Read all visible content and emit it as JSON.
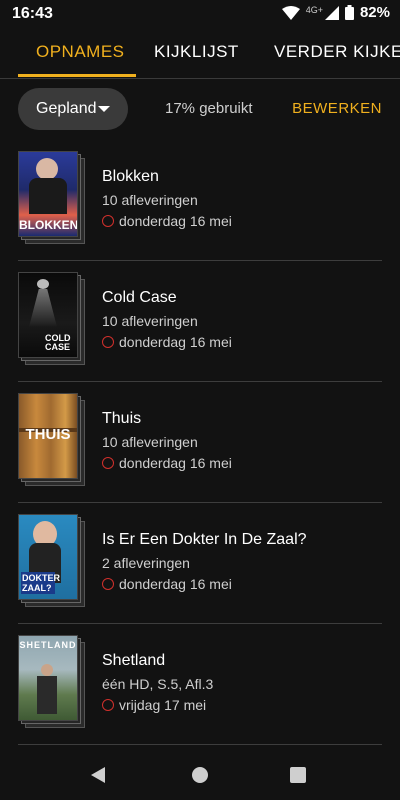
{
  "status_bar": {
    "time": "16:43",
    "network": "4G+",
    "battery": "82%"
  },
  "tabs": [
    {
      "label": "OPNAMES",
      "active": true
    },
    {
      "label": "KIJKLIJST",
      "active": false
    },
    {
      "label": "VERDER KIJKEN",
      "active": false
    }
  ],
  "filter": {
    "dropdown_label": "Gepland",
    "usage": "17% gebruikt",
    "edit_label": "BEWERKEN"
  },
  "recordings": [
    {
      "title": "Blokken",
      "subtitle": "10 afleveringen",
      "date": "donderdag 16 mei",
      "poster_text": "BLOKKEN"
    },
    {
      "title": "Cold Case",
      "subtitle": "10 afleveringen",
      "date": "donderdag 16 mei",
      "poster_text": "COLD CASE"
    },
    {
      "title": "Thuis",
      "subtitle": "10 afleveringen",
      "date": "donderdag 16 mei",
      "poster_text": "THUIS"
    },
    {
      "title": "Is Er Een Dokter In De Zaal?",
      "subtitle": "2 afleveringen",
      "date": "donderdag 16 mei",
      "poster_text": "DOKTER ZAAL?"
    },
    {
      "title": "Shetland",
      "subtitle": "één HD, S.5, Afl.3",
      "date": "vrijdag 17 mei",
      "poster_text": "SHETLAND"
    }
  ],
  "colors": {
    "accent": "#f0b01e",
    "record": "#d0302c",
    "background": "#121212"
  },
  "icons": {
    "wifi": "wifi-icon",
    "signal": "signal-icon",
    "battery": "battery-icon",
    "record": "record-circle-icon",
    "caret": "caret-down-icon"
  }
}
